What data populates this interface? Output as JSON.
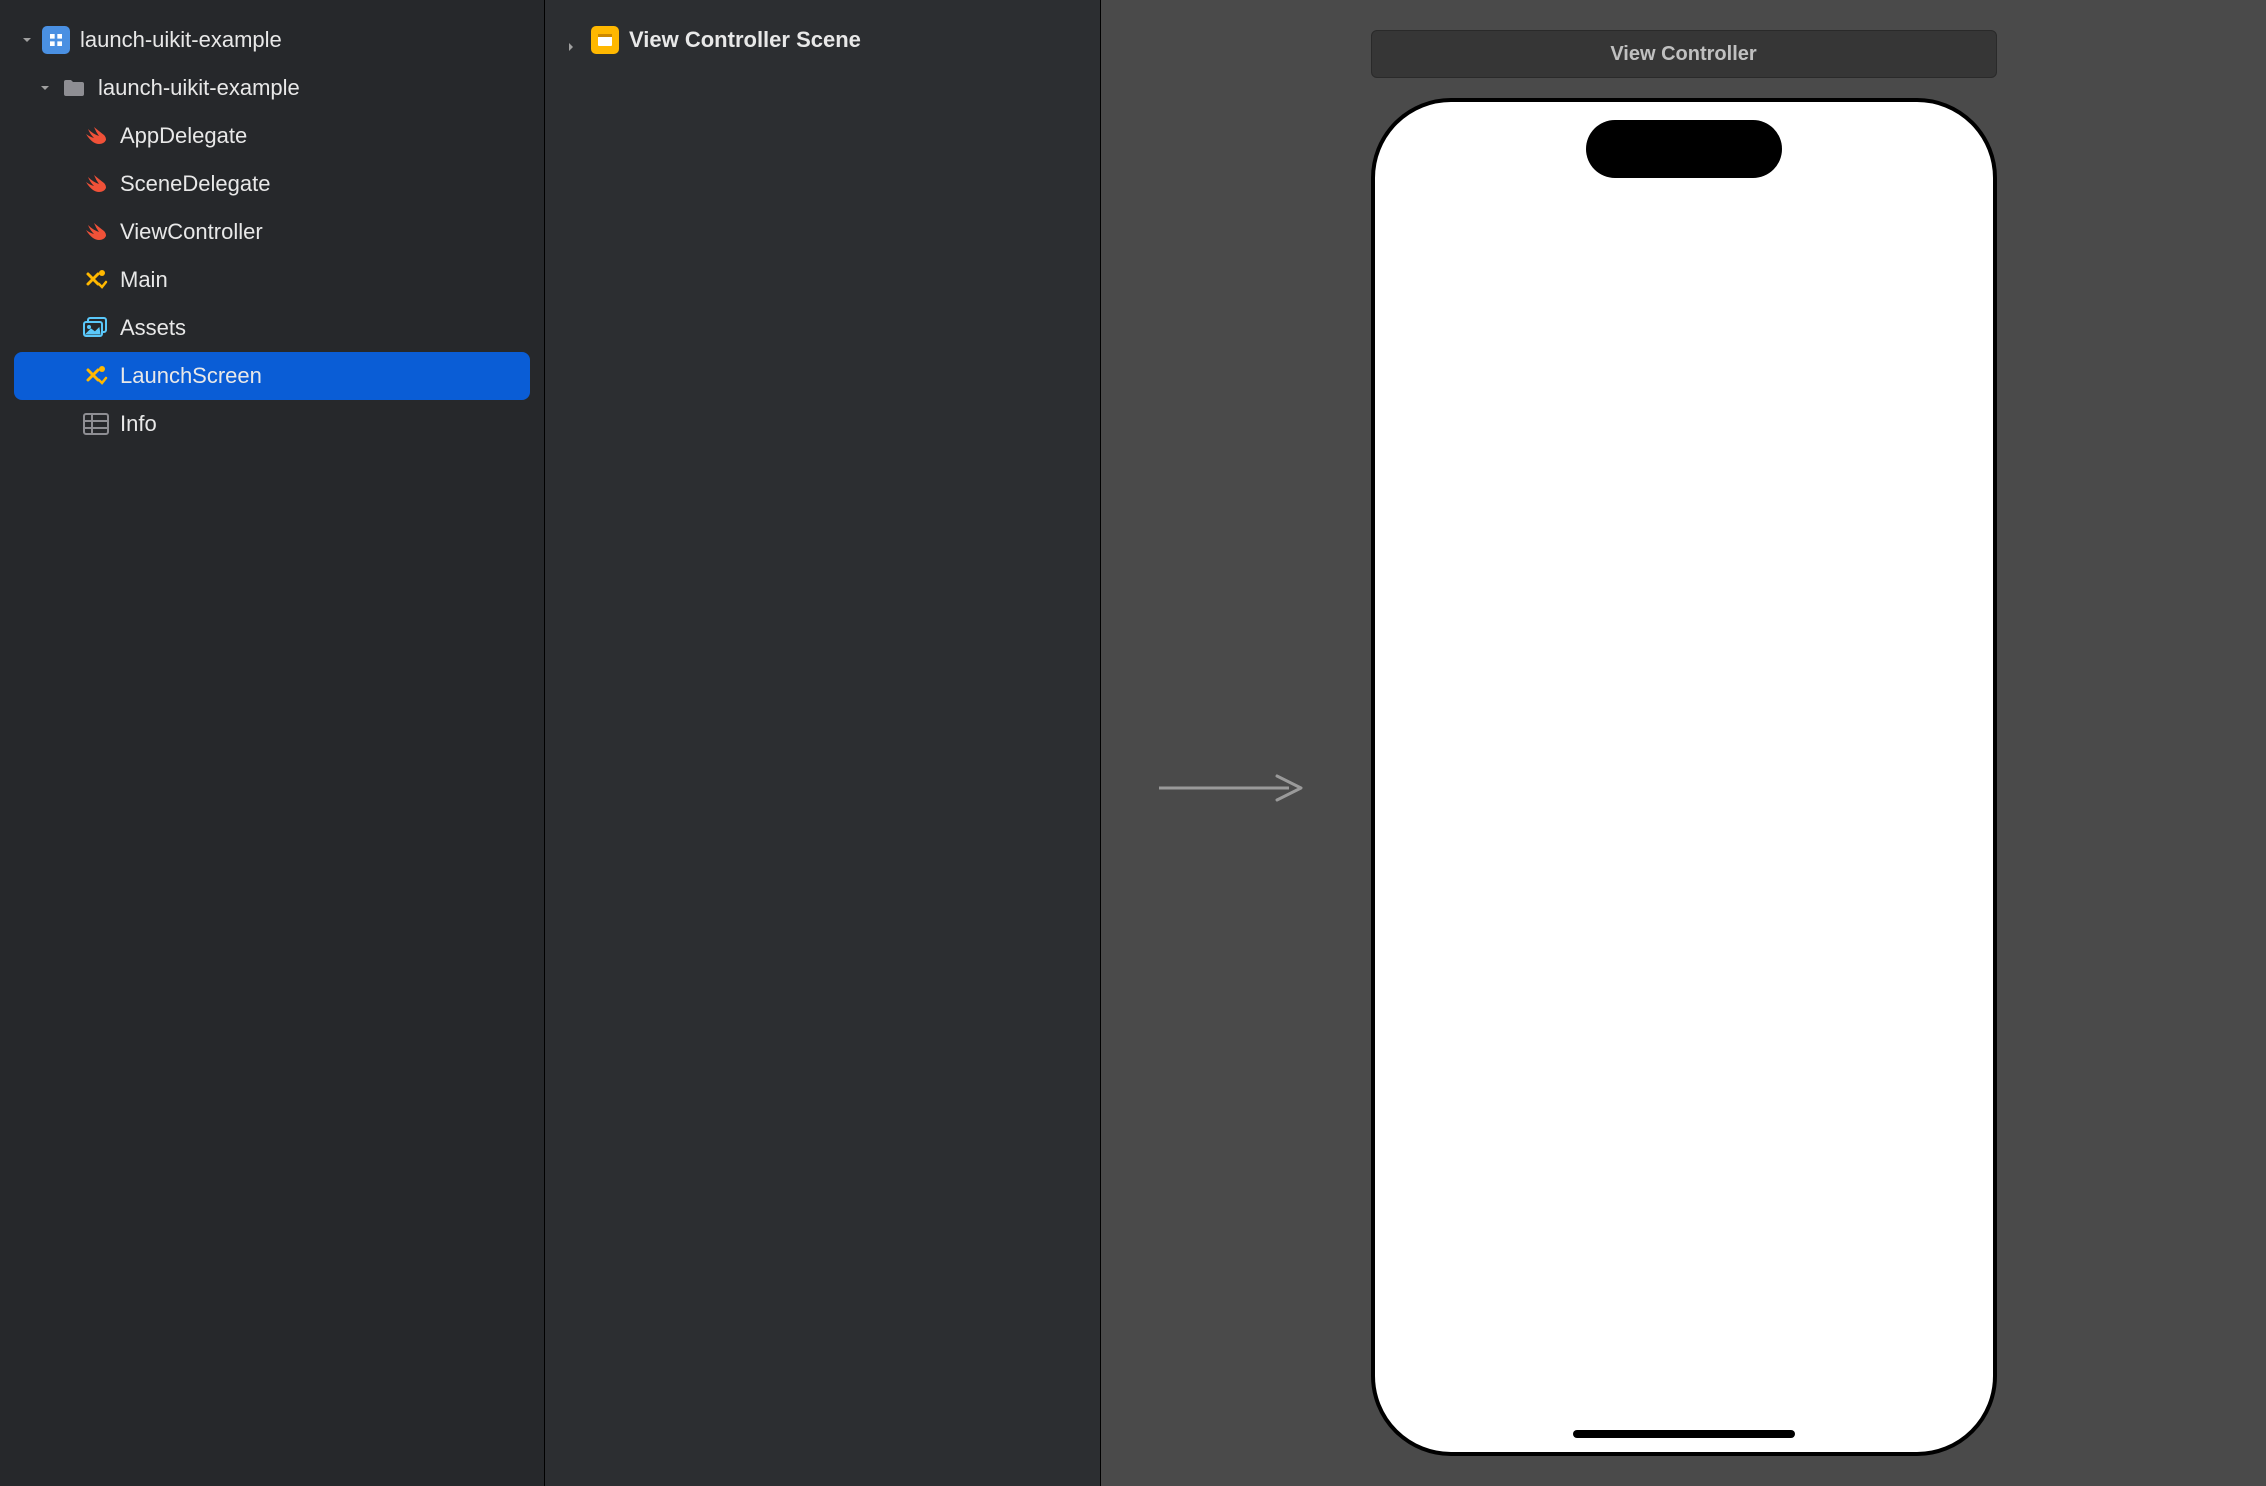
{
  "navigator": {
    "project": {
      "name": "launch-uikit-example"
    },
    "folder": {
      "name": "launch-uikit-example"
    },
    "files": [
      {
        "name": "AppDelegate",
        "icon": "swift",
        "selected": false
      },
      {
        "name": "SceneDelegate",
        "icon": "swift",
        "selected": false
      },
      {
        "name": "ViewController",
        "icon": "swift",
        "selected": false
      },
      {
        "name": "Main",
        "icon": "storyboard",
        "selected": false
      },
      {
        "name": "Assets",
        "icon": "assets",
        "selected": false
      },
      {
        "name": "LaunchScreen",
        "icon": "storyboard",
        "selected": true
      },
      {
        "name": "Info",
        "icon": "info",
        "selected": false
      }
    ]
  },
  "outline": {
    "scene": "View Controller Scene"
  },
  "canvas": {
    "label": "View Controller"
  },
  "colors": {
    "selection": "#0a5dd6",
    "swift_orange": "#f05138",
    "storyboard_yellow": "#ffb800",
    "assets_blue": "#5ac8fa"
  }
}
